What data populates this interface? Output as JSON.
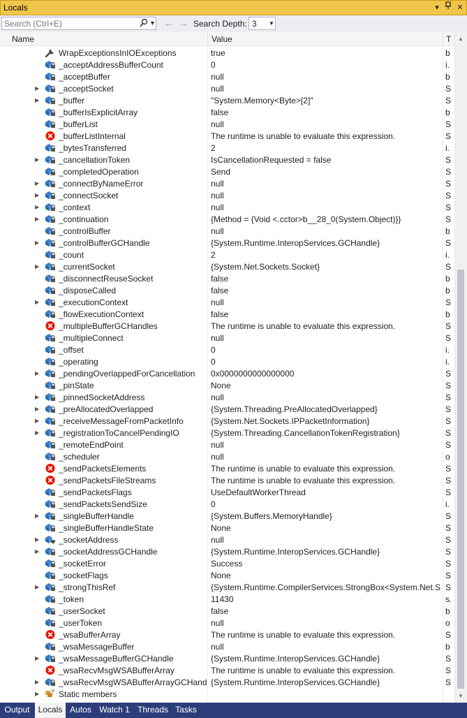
{
  "window": {
    "title": "Locals"
  },
  "toolbar": {
    "search_placeholder": "Search (Ctrl+E)",
    "depth_label": "Search Depth:",
    "depth_value": "3"
  },
  "columns": {
    "name": "Name",
    "value": "Value",
    "type": "T"
  },
  "rows": [
    {
      "name": "WrapExceptionsInIOExceptions",
      "value": "true",
      "type": "b",
      "icon": "wrench-icon",
      "expandable": false
    },
    {
      "name": "_acceptAddressBufferCount",
      "value": "0",
      "type": "i.",
      "icon": "field-lock-icon",
      "expandable": false
    },
    {
      "name": "_acceptBuffer",
      "value": "null",
      "type": "b",
      "icon": "field-lock-icon",
      "expandable": false
    },
    {
      "name": "_acceptSocket",
      "value": "null",
      "type": "S",
      "icon": "field-lock-icon",
      "expandable": true
    },
    {
      "name": "_buffer",
      "value": "\"System.Memory<Byte>[2]\"",
      "type": "S",
      "icon": "field-lock-icon",
      "expandable": true
    },
    {
      "name": "_bufferIsExplicitArray",
      "value": "false",
      "type": "b",
      "icon": "field-lock-icon",
      "expandable": false
    },
    {
      "name": "_bufferList",
      "value": "null",
      "type": "S",
      "icon": "field-lock-icon",
      "expandable": false
    },
    {
      "name": "_bufferListInternal",
      "value": "The runtime is unable to evaluate this expression.",
      "type": "S",
      "icon": "error-icon",
      "expandable": false
    },
    {
      "name": "_bytesTransferred",
      "value": "2",
      "type": "i.",
      "icon": "field-lock-icon",
      "expandable": false
    },
    {
      "name": "_cancellationToken",
      "value": "IsCancellationRequested = false",
      "type": "S",
      "icon": "field-lock-icon",
      "expandable": true
    },
    {
      "name": "_completedOperation",
      "value": "Send",
      "type": "S",
      "icon": "field-lock-icon",
      "expandable": false
    },
    {
      "name": "_connectByNameError",
      "value": "null",
      "type": "S",
      "icon": "field-lock-icon",
      "expandable": true
    },
    {
      "name": "_connectSocket",
      "value": "null",
      "type": "S",
      "icon": "field-lock-icon",
      "expandable": true
    },
    {
      "name": "_context",
      "value": "null",
      "type": "S",
      "icon": "field-lock-icon",
      "expandable": true
    },
    {
      "name": "_continuation",
      "value": "{Method = {Void <.cctor>b__28_0(System.Object)}}",
      "type": "S",
      "icon": "field-lock-icon",
      "expandable": true
    },
    {
      "name": "_controlBuffer",
      "value": "null",
      "type": "b",
      "icon": "field-lock-icon",
      "expandable": false
    },
    {
      "name": "_controlBufferGCHandle",
      "value": "{System.Runtime.InteropServices.GCHandle}",
      "type": "S",
      "icon": "field-lock-icon",
      "expandable": true
    },
    {
      "name": "_count",
      "value": "2",
      "type": "i.",
      "icon": "field-lock-icon",
      "expandable": false
    },
    {
      "name": "_currentSocket",
      "value": "{System.Net.Sockets.Socket}",
      "type": "S",
      "icon": "field-lock-icon",
      "expandable": true
    },
    {
      "name": "_disconnectReuseSocket",
      "value": "false",
      "type": "b",
      "icon": "field-lock-icon",
      "expandable": false
    },
    {
      "name": "_disposeCalled",
      "value": "false",
      "type": "b",
      "icon": "field-lock-icon",
      "expandable": false
    },
    {
      "name": "_executionContext",
      "value": "null",
      "type": "S",
      "icon": "field-lock-icon",
      "expandable": true
    },
    {
      "name": "_flowExecutionContext",
      "value": "false",
      "type": "b",
      "icon": "field-lock-icon",
      "expandable": false
    },
    {
      "name": "_multipleBufferGCHandles",
      "value": "The runtime is unable to evaluate this expression.",
      "type": "S",
      "icon": "error-icon",
      "expandable": false
    },
    {
      "name": "_multipleConnect",
      "value": "null",
      "type": "S",
      "icon": "field-lock-icon",
      "expandable": false
    },
    {
      "name": "_offset",
      "value": "0",
      "type": "i.",
      "icon": "field-lock-icon",
      "expandable": false
    },
    {
      "name": "_operating",
      "value": "0",
      "type": "i.",
      "icon": "field-lock-icon",
      "expandable": false
    },
    {
      "name": "_pendingOverlappedForCancellation",
      "value": "0x0000000000000000",
      "type": "S",
      "icon": "field-lock-icon",
      "expandable": true
    },
    {
      "name": "_pinState",
      "value": "None",
      "type": "S",
      "icon": "field-lock-icon",
      "expandable": false
    },
    {
      "name": "_pinnedSocketAddress",
      "value": "null",
      "type": "S",
      "icon": "field-lock-icon",
      "expandable": true
    },
    {
      "name": "_preAllocatedOverlapped",
      "value": "{System.Threading.PreAllocatedOverlapped}",
      "type": "S",
      "icon": "field-lock-icon",
      "expandable": true
    },
    {
      "name": "_receiveMessageFromPacketInfo",
      "value": "{System.Net.Sockets.IPPacketInformation}",
      "type": "S",
      "icon": "field-lock-icon",
      "expandable": true
    },
    {
      "name": "_registrationToCancelPendingIO",
      "value": "{System.Threading.CancellationTokenRegistration}",
      "type": "S",
      "icon": "field-lock-icon",
      "expandable": true
    },
    {
      "name": "_remoteEndPoint",
      "value": "null",
      "type": "S",
      "icon": "field-lock-icon",
      "expandable": false
    },
    {
      "name": "_scheduler",
      "value": "null",
      "type": "o",
      "icon": "field-lock-icon",
      "expandable": false
    },
    {
      "name": "_sendPacketsElements",
      "value": "The runtime is unable to evaluate this expression.",
      "type": "S",
      "icon": "error-icon",
      "expandable": false
    },
    {
      "name": "_sendPacketsFileStreams",
      "value": "The runtime is unable to evaluate this expression.",
      "type": "S",
      "icon": "error-icon",
      "expandable": false
    },
    {
      "name": "_sendPacketsFlags",
      "value": "UseDefaultWorkerThread",
      "type": "S",
      "icon": "field-lock-icon",
      "expandable": false
    },
    {
      "name": "_sendPacketsSendSize",
      "value": "0",
      "type": "i.",
      "icon": "field-lock-icon",
      "expandable": false
    },
    {
      "name": "_singleBufferHandle",
      "value": "{System.Buffers.MemoryHandle}",
      "type": "S",
      "icon": "field-lock-icon",
      "expandable": true
    },
    {
      "name": "_singleBufferHandleState",
      "value": "None",
      "type": "S",
      "icon": "field-lock-icon",
      "expandable": false
    },
    {
      "name": "_socketAddress",
      "value": "null",
      "type": "S",
      "icon": "field-heart-icon",
      "expandable": true
    },
    {
      "name": "_socketAddressGCHandle",
      "value": "{System.Runtime.InteropServices.GCHandle}",
      "type": "S",
      "icon": "field-lock-icon",
      "expandable": true
    },
    {
      "name": "_socketError",
      "value": "Success",
      "type": "S",
      "icon": "field-lock-icon",
      "expandable": false
    },
    {
      "name": "_socketFlags",
      "value": "None",
      "type": "S",
      "icon": "field-lock-icon",
      "expandable": false
    },
    {
      "name": "_strongThisRef",
      "value": "{System.Runtime.CompilerServices.StrongBox<System.Net.S...",
      "type": "S",
      "icon": "field-lock-icon",
      "expandable": true
    },
    {
      "name": "_token",
      "value": "11430",
      "type": "s.",
      "icon": "field-lock-icon",
      "expandable": false
    },
    {
      "name": "_userSocket",
      "value": "false",
      "type": "b",
      "icon": "field-lock-icon",
      "expandable": false
    },
    {
      "name": "_userToken",
      "value": "null",
      "type": "o",
      "icon": "field-lock-icon",
      "expandable": false
    },
    {
      "name": "_wsaBufferArray",
      "value": "The runtime is unable to evaluate this expression.",
      "type": "S",
      "icon": "error-icon",
      "expandable": false
    },
    {
      "name": "_wsaMessageBuffer",
      "value": "null",
      "type": "b",
      "icon": "field-lock-icon",
      "expandable": false
    },
    {
      "name": "_wsaMessageBufferGCHandle",
      "value": "{System.Runtime.InteropServices.GCHandle}",
      "type": "S",
      "icon": "field-lock-icon",
      "expandable": true
    },
    {
      "name": "_wsaRecvMsgWSABufferArray",
      "value": "The runtime is unable to evaluate this expression.",
      "type": "S",
      "icon": "error-icon",
      "expandable": false
    },
    {
      "name": "_wsaRecvMsgWSABufferArrayGCHandle",
      "value": "{System.Runtime.InteropServices.GCHandle}",
      "type": "S",
      "icon": "field-lock-icon",
      "expandable": true
    },
    {
      "name": "Static members",
      "value": "",
      "type": "",
      "icon": "static-members-icon",
      "expandable": true
    }
  ],
  "bottom_tabs": [
    {
      "label": "Output",
      "active": false
    },
    {
      "label": "Locals",
      "active": true
    },
    {
      "label": "Autos",
      "active": false
    },
    {
      "label": "Watch 1",
      "active": false
    },
    {
      "label": "Threads",
      "active": false
    },
    {
      "label": "Tasks",
      "active": false
    }
  ],
  "colors": {
    "title_bar": "#f0c64a",
    "tab_strip": "#2c3e7a",
    "error_red": "#e51400",
    "field_blue": "#1e6bb8"
  }
}
